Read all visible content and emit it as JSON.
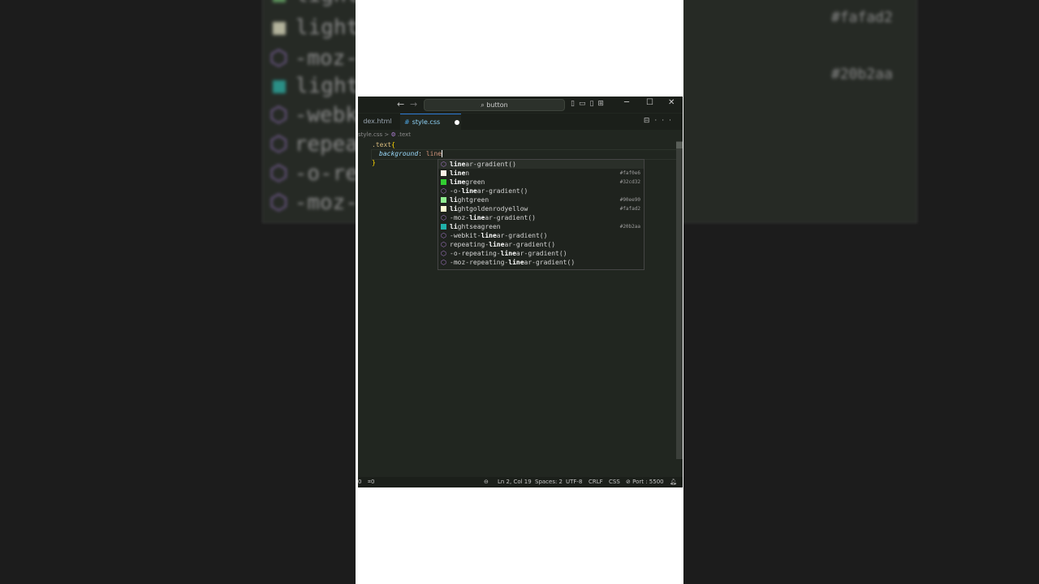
{
  "background": {
    "items": [
      {
        "label": "light",
        "kind": "color",
        "color": "#90ee90"
      },
      {
        "label": "light",
        "kind": "color",
        "color": "#fafad2"
      },
      {
        "label": "-moz-",
        "kind": "function"
      },
      {
        "label": "light",
        "kind": "color",
        "color": "#20b2aa"
      },
      {
        "label": "-webk",
        "kind": "function"
      },
      {
        "label": "repea",
        "kind": "function"
      },
      {
        "label": "-o-re",
        "kind": "function"
      },
      {
        "label": "-moz-",
        "kind": "function"
      }
    ],
    "details": [
      "#90ee90",
      "#fafad2",
      "#20b2aa"
    ]
  },
  "titlebar": {
    "search_text": "button",
    "back_icon": "arrow-left-icon",
    "forward_icon": "arrow-right-icon"
  },
  "tabs": [
    {
      "label": "dex.html",
      "active": false
    },
    {
      "label": "style.css",
      "active": true,
      "modified": true
    }
  ],
  "breadcrumb": {
    "file": "style.css",
    "sep": ">",
    "symbol": ".text"
  },
  "editor": {
    "line1_selector": ".text",
    "line1_brace": "{",
    "line2_property": "background",
    "line2_colon": ":",
    "line2_value": "line",
    "line3_brace": "}"
  },
  "suggestions": [
    {
      "pre": "",
      "match": "line",
      "post": "ar-gradient()",
      "kind": "function",
      "detail": ""
    },
    {
      "pre": "",
      "match": "line",
      "post": "n",
      "kind": "color",
      "color": "#faf0e6",
      "detail": "#faf0e6"
    },
    {
      "pre": "",
      "match": "lime",
      "post": "green",
      "kind": "color",
      "color": "#32cd32",
      "detail": "#32cd32"
    },
    {
      "pre": "-o-",
      "match": "line",
      "post": "ar-gradient()",
      "kind": "function",
      "detail": ""
    },
    {
      "pre": "",
      "match": "li",
      "post": "ghtgreen",
      "kind": "color",
      "color": "#90ee90",
      "detail": "#90ee90"
    },
    {
      "pre": "",
      "match": "li",
      "post": "ghtgoldenrodyellow",
      "kind": "color",
      "color": "#fafad2",
      "detail": "#fafad2"
    },
    {
      "pre": "-moz-",
      "match": "line",
      "post": "ar-gradient()",
      "kind": "function",
      "detail": ""
    },
    {
      "pre": "",
      "match": "li",
      "post": "ghtseagreen",
      "kind": "color",
      "color": "#20b2aa",
      "detail": "#20b2aa"
    },
    {
      "pre": "-webkit-",
      "match": "line",
      "post": "ar-gradient()",
      "kind": "function",
      "detail": ""
    },
    {
      "pre": "repeating-",
      "match": "line",
      "post": "ar-gradient()",
      "kind": "function",
      "detail": ""
    },
    {
      "pre": "-o-repeating-",
      "match": "line",
      "post": "ar-gradient()",
      "kind": "function",
      "detail": ""
    },
    {
      "pre": "-moz-repeating-",
      "match": "line",
      "post": "ar-gradient()",
      "kind": "function",
      "detail": ""
    }
  ],
  "statusbar": {
    "errors": "0",
    "ports": "0",
    "position": "Ln 2, Col 19",
    "spaces": "Spaces: 2",
    "encoding": "UTF-8",
    "eol": "CRLF",
    "language": "CSS",
    "port": "Port : 5500"
  }
}
